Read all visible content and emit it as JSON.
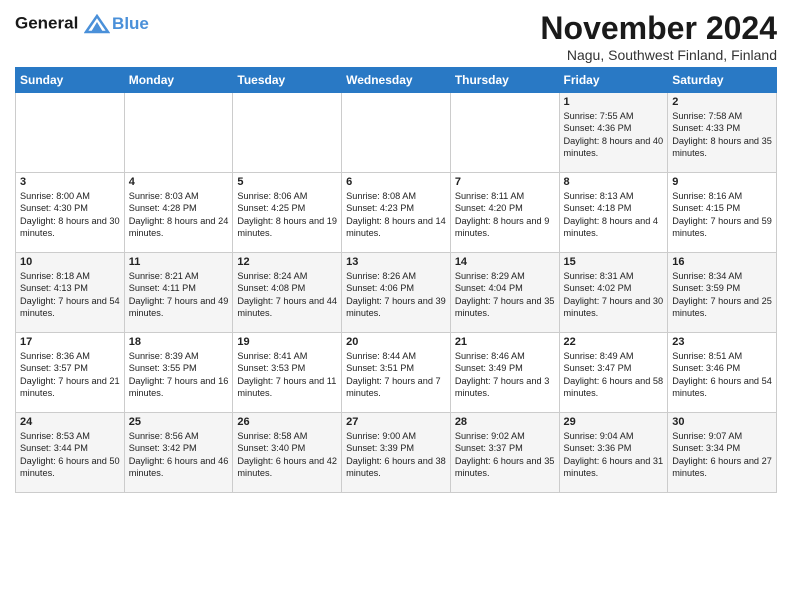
{
  "header": {
    "logo_line1": "General",
    "logo_line2": "Blue",
    "month_title": "November 2024",
    "subtitle": "Nagu, Southwest Finland, Finland"
  },
  "days_of_week": [
    "Sunday",
    "Monday",
    "Tuesday",
    "Wednesday",
    "Thursday",
    "Friday",
    "Saturday"
  ],
  "weeks": [
    [
      {
        "day": "",
        "info": ""
      },
      {
        "day": "",
        "info": ""
      },
      {
        "day": "",
        "info": ""
      },
      {
        "day": "",
        "info": ""
      },
      {
        "day": "",
        "info": ""
      },
      {
        "day": "1",
        "info": "Sunrise: 7:55 AM\nSunset: 4:36 PM\nDaylight: 8 hours and 40 minutes."
      },
      {
        "day": "2",
        "info": "Sunrise: 7:58 AM\nSunset: 4:33 PM\nDaylight: 8 hours and 35 minutes."
      }
    ],
    [
      {
        "day": "3",
        "info": "Sunrise: 8:00 AM\nSunset: 4:30 PM\nDaylight: 8 hours and 30 minutes."
      },
      {
        "day": "4",
        "info": "Sunrise: 8:03 AM\nSunset: 4:28 PM\nDaylight: 8 hours and 24 minutes."
      },
      {
        "day": "5",
        "info": "Sunrise: 8:06 AM\nSunset: 4:25 PM\nDaylight: 8 hours and 19 minutes."
      },
      {
        "day": "6",
        "info": "Sunrise: 8:08 AM\nSunset: 4:23 PM\nDaylight: 8 hours and 14 minutes."
      },
      {
        "day": "7",
        "info": "Sunrise: 8:11 AM\nSunset: 4:20 PM\nDaylight: 8 hours and 9 minutes."
      },
      {
        "day": "8",
        "info": "Sunrise: 8:13 AM\nSunset: 4:18 PM\nDaylight: 8 hours and 4 minutes."
      },
      {
        "day": "9",
        "info": "Sunrise: 8:16 AM\nSunset: 4:15 PM\nDaylight: 7 hours and 59 minutes."
      }
    ],
    [
      {
        "day": "10",
        "info": "Sunrise: 8:18 AM\nSunset: 4:13 PM\nDaylight: 7 hours and 54 minutes."
      },
      {
        "day": "11",
        "info": "Sunrise: 8:21 AM\nSunset: 4:11 PM\nDaylight: 7 hours and 49 minutes."
      },
      {
        "day": "12",
        "info": "Sunrise: 8:24 AM\nSunset: 4:08 PM\nDaylight: 7 hours and 44 minutes."
      },
      {
        "day": "13",
        "info": "Sunrise: 8:26 AM\nSunset: 4:06 PM\nDaylight: 7 hours and 39 minutes."
      },
      {
        "day": "14",
        "info": "Sunrise: 8:29 AM\nSunset: 4:04 PM\nDaylight: 7 hours and 35 minutes."
      },
      {
        "day": "15",
        "info": "Sunrise: 8:31 AM\nSunset: 4:02 PM\nDaylight: 7 hours and 30 minutes."
      },
      {
        "day": "16",
        "info": "Sunrise: 8:34 AM\nSunset: 3:59 PM\nDaylight: 7 hours and 25 minutes."
      }
    ],
    [
      {
        "day": "17",
        "info": "Sunrise: 8:36 AM\nSunset: 3:57 PM\nDaylight: 7 hours and 21 minutes."
      },
      {
        "day": "18",
        "info": "Sunrise: 8:39 AM\nSunset: 3:55 PM\nDaylight: 7 hours and 16 minutes."
      },
      {
        "day": "19",
        "info": "Sunrise: 8:41 AM\nSunset: 3:53 PM\nDaylight: 7 hours and 11 minutes."
      },
      {
        "day": "20",
        "info": "Sunrise: 8:44 AM\nSunset: 3:51 PM\nDaylight: 7 hours and 7 minutes."
      },
      {
        "day": "21",
        "info": "Sunrise: 8:46 AM\nSunset: 3:49 PM\nDaylight: 7 hours and 3 minutes."
      },
      {
        "day": "22",
        "info": "Sunrise: 8:49 AM\nSunset: 3:47 PM\nDaylight: 6 hours and 58 minutes."
      },
      {
        "day": "23",
        "info": "Sunrise: 8:51 AM\nSunset: 3:46 PM\nDaylight: 6 hours and 54 minutes."
      }
    ],
    [
      {
        "day": "24",
        "info": "Sunrise: 8:53 AM\nSunset: 3:44 PM\nDaylight: 6 hours and 50 minutes."
      },
      {
        "day": "25",
        "info": "Sunrise: 8:56 AM\nSunset: 3:42 PM\nDaylight: 6 hours and 46 minutes."
      },
      {
        "day": "26",
        "info": "Sunrise: 8:58 AM\nSunset: 3:40 PM\nDaylight: 6 hours and 42 minutes."
      },
      {
        "day": "27",
        "info": "Sunrise: 9:00 AM\nSunset: 3:39 PM\nDaylight: 6 hours and 38 minutes."
      },
      {
        "day": "28",
        "info": "Sunrise: 9:02 AM\nSunset: 3:37 PM\nDaylight: 6 hours and 35 minutes."
      },
      {
        "day": "29",
        "info": "Sunrise: 9:04 AM\nSunset: 3:36 PM\nDaylight: 6 hours and 31 minutes."
      },
      {
        "day": "30",
        "info": "Sunrise: 9:07 AM\nSunset: 3:34 PM\nDaylight: 6 hours and 27 minutes."
      }
    ]
  ]
}
